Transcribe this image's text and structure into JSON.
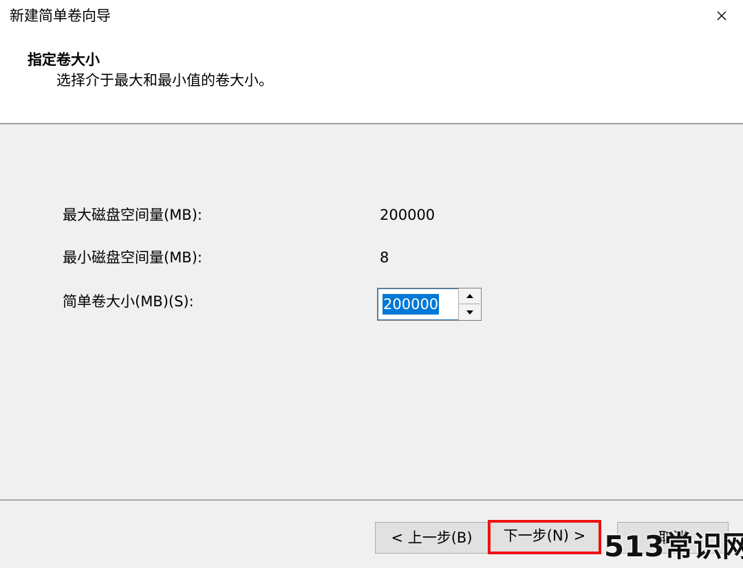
{
  "window": {
    "title": "新建简单卷向导",
    "close_icon": "close-icon"
  },
  "header": {
    "title": "指定卷大小",
    "description": "选择介于最大和最小值的卷大小。"
  },
  "fields": {
    "max_label": "最大磁盘空间量(MB):",
    "max_value": "200000",
    "min_label": "最小磁盘空间量(MB):",
    "min_value": "8",
    "size_label": "简单卷大小(MB)(S):",
    "size_value": "200000"
  },
  "buttons": {
    "back": "< 上一步(B)",
    "next": "下一步(N) >",
    "cancel": "取消"
  },
  "watermark": "513常识网",
  "colors": {
    "selection": "#0078d7",
    "highlight_border": "#ee1111"
  }
}
